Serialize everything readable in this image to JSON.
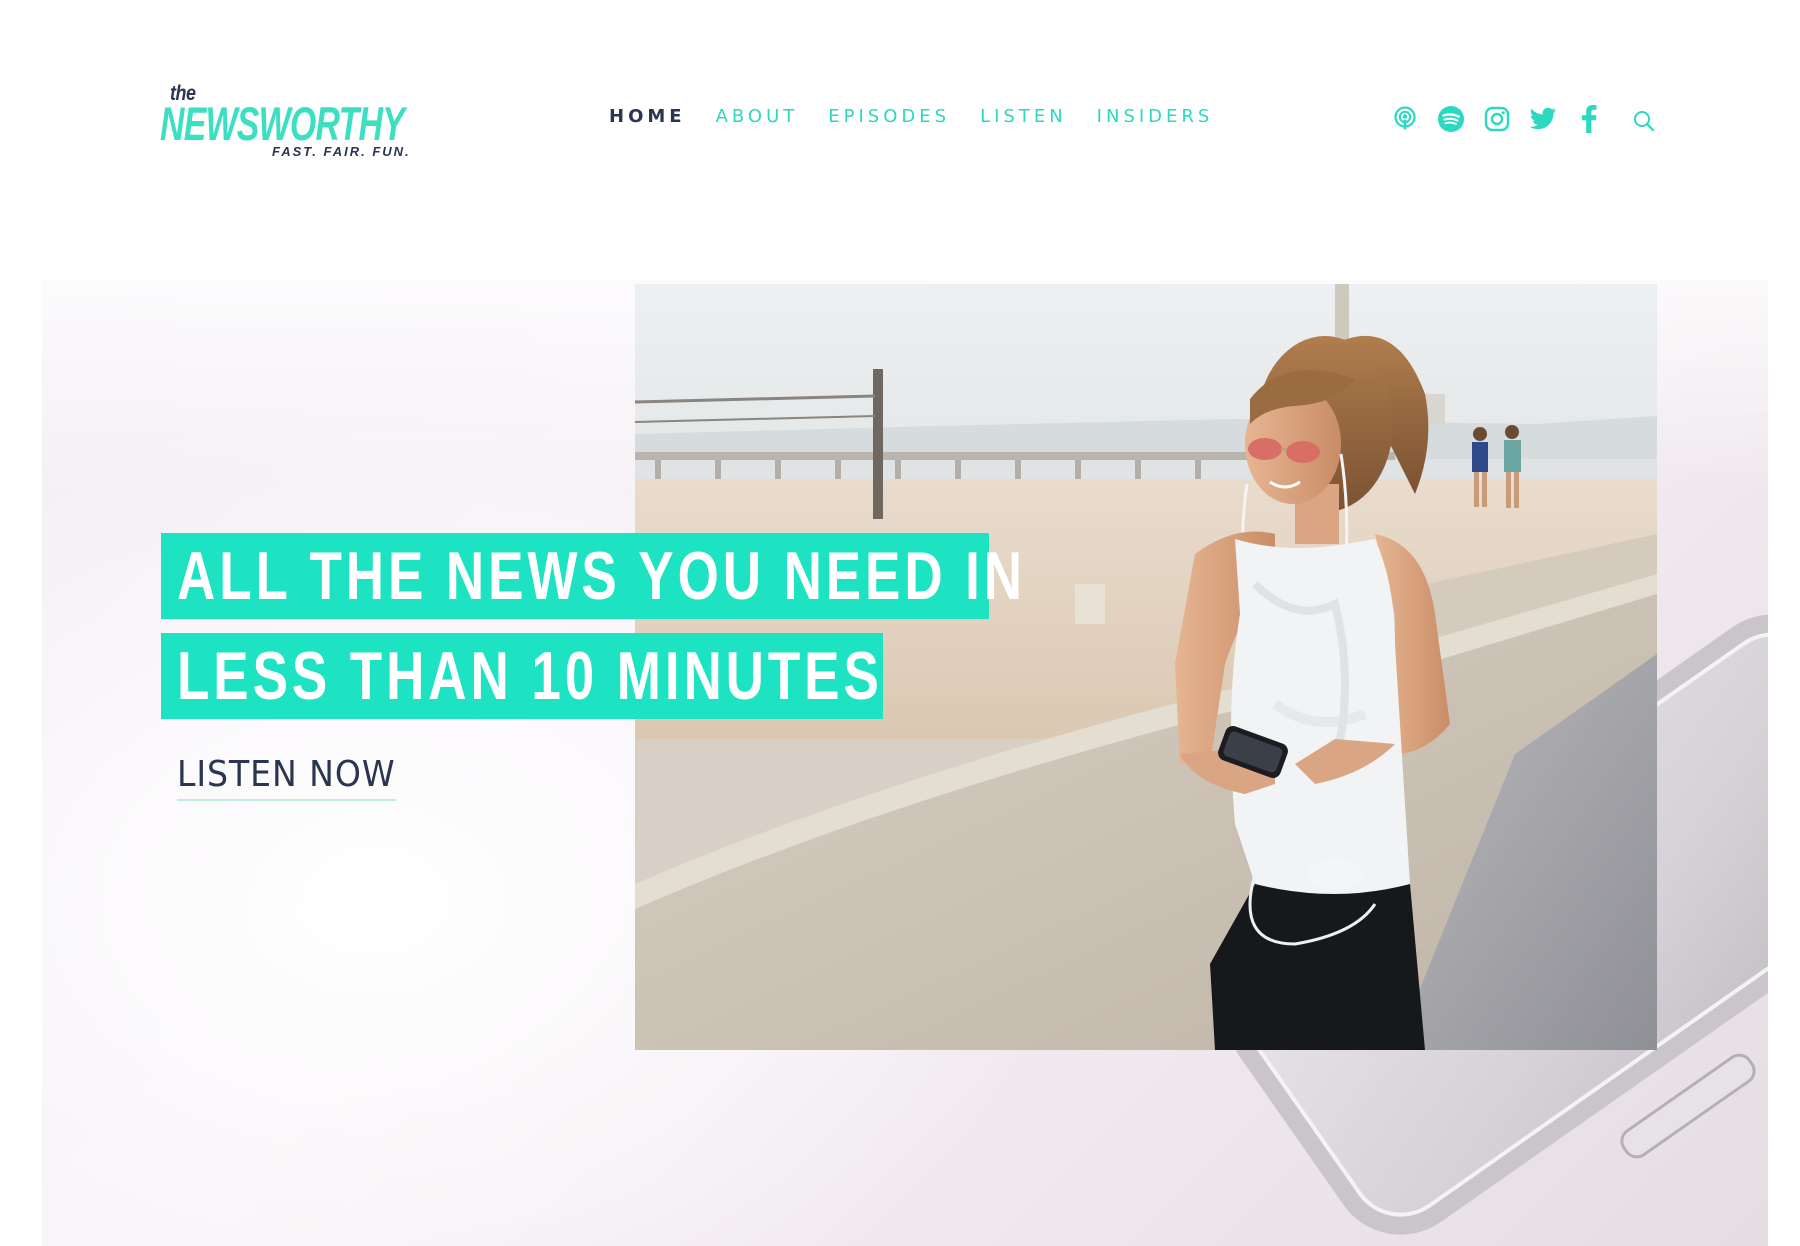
{
  "logo": {
    "the": "the",
    "name": "NEWSWORTHY",
    "tagline": "FAST. FAIR. FUN."
  },
  "nav": {
    "items": [
      {
        "label": "HOME",
        "active": true
      },
      {
        "label": "ABOUT",
        "active": false
      },
      {
        "label": "EPISODES",
        "active": false
      },
      {
        "label": "LISTEN",
        "active": false
      },
      {
        "label": "INSIDERS",
        "active": false
      }
    ]
  },
  "socials": [
    "apple-podcasts-icon",
    "spotify-icon",
    "instagram-icon",
    "twitter-icon",
    "facebook-icon"
  ],
  "search_icon": "search-icon",
  "hero": {
    "headline_line1": "ALL THE NEWS YOU NEED IN",
    "headline_line2": "LESS THAN 10 MINUTES",
    "cta": "LISTEN NOW",
    "photo": "woman-with-phone-and-earbuds-on-boardwalk-photo"
  },
  "colors": {
    "accent": "#1de3c2",
    "nav_link": "#2ad9c0",
    "dark": "#2a3550",
    "background": "#ffffff"
  }
}
